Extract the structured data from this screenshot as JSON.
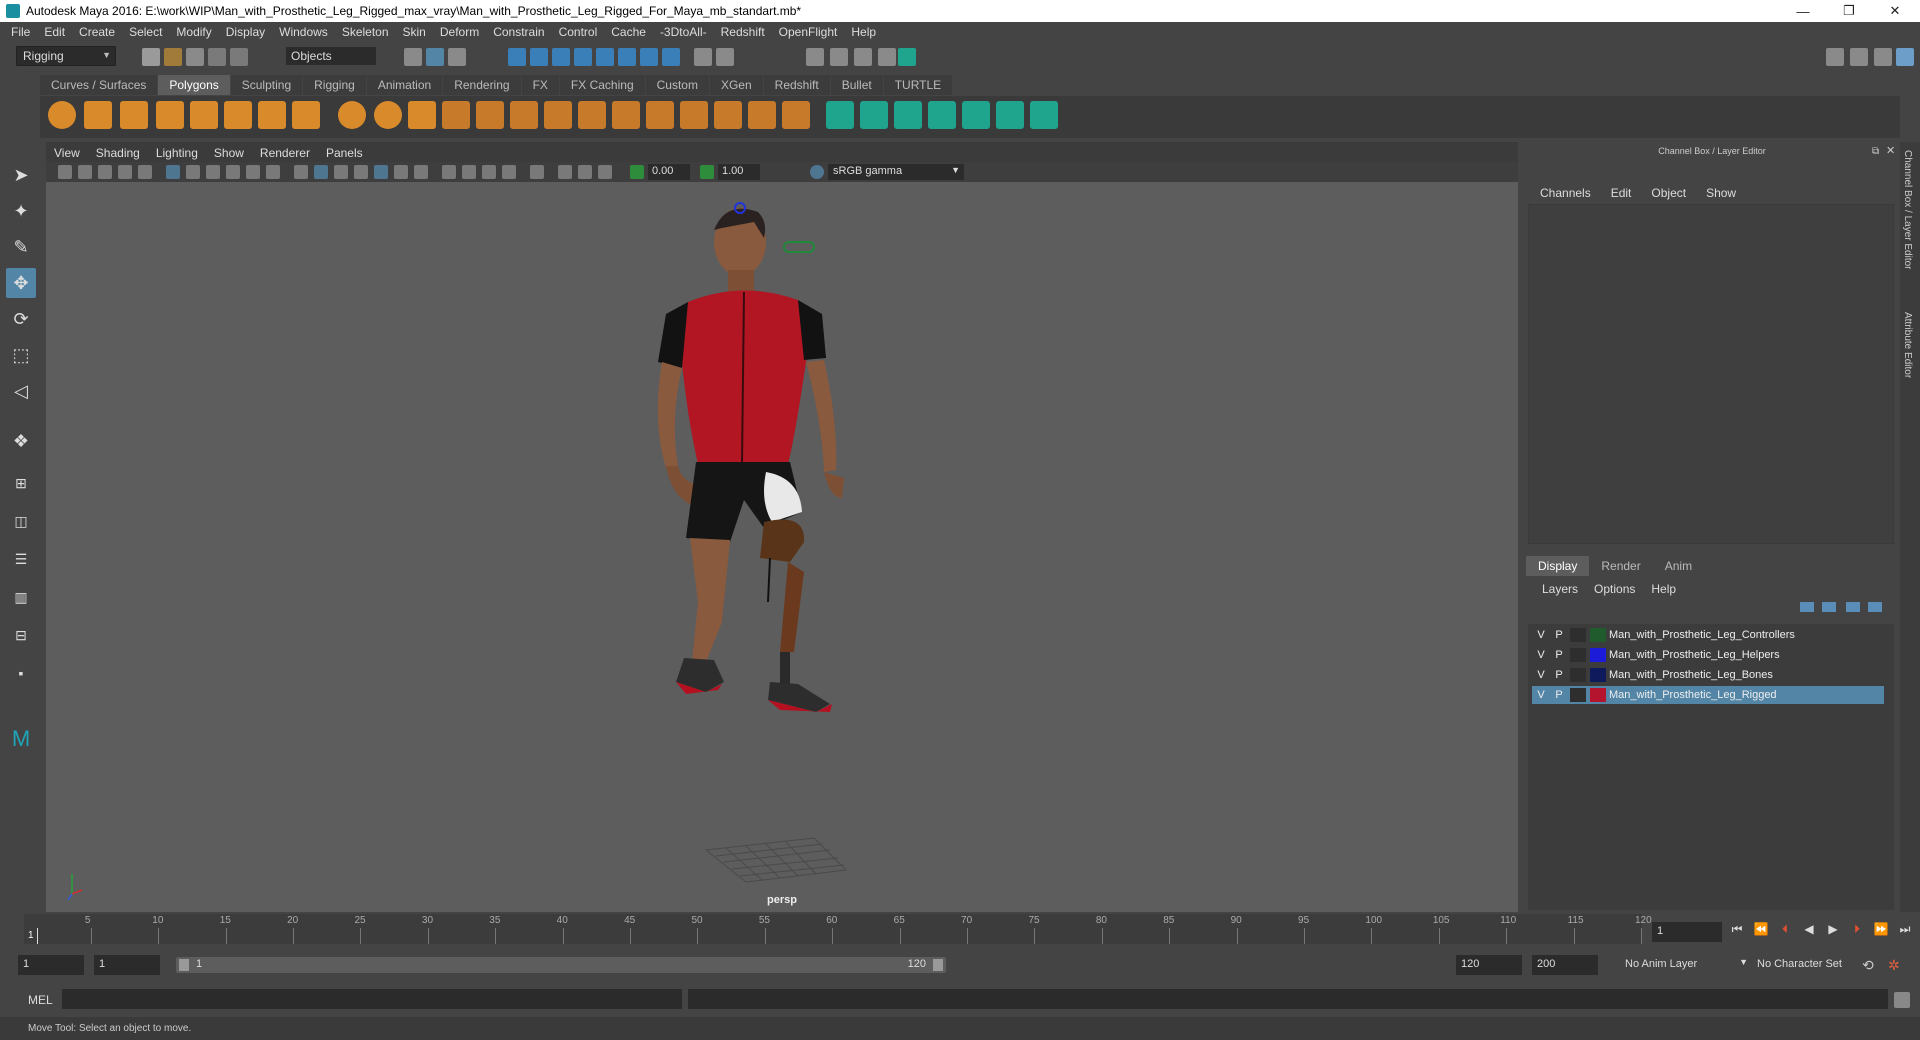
{
  "title_bar": {
    "title": "Autodesk Maya 2016: E:\\work\\WIP\\Man_with_Prosthetic_Leg_Rigged_max_vray\\Man_with_Prosthetic_Leg_Rigged_For_Maya_mb_standart.mb*",
    "minimize": "—",
    "restore": "❐",
    "close": "✕"
  },
  "menu": [
    "File",
    "Edit",
    "Create",
    "Select",
    "Modify",
    "Display",
    "Windows",
    "Skeleton",
    "Skin",
    "Deform",
    "Constrain",
    "Control",
    "Cache",
    "-3DtoAll-",
    "Redshift",
    "OpenFlight",
    "Help"
  ],
  "toolbar": {
    "mode": "Rigging",
    "selection_field": "Objects"
  },
  "shelf_tabs": [
    "Curves / Surfaces",
    "Polygons",
    "Sculpting",
    "Rigging",
    "Animation",
    "Rendering",
    "FX",
    "FX Caching",
    "Custom",
    "XGen",
    "Redshift",
    "Bullet",
    "TURTLE"
  ],
  "active_shelf_tab": "Polygons",
  "panel_menu": [
    "View",
    "Shading",
    "Lighting",
    "Show",
    "Renderer",
    "Panels"
  ],
  "panel_toolbar": {
    "exposure": "0.00",
    "gamma": "1.00",
    "color_space": "sRGB gamma"
  },
  "viewport": {
    "camera_label": "persp"
  },
  "channel_box": {
    "title": "Channel Box / Layer Editor",
    "menu": [
      "Channels",
      "Edit",
      "Object",
      "Show"
    ]
  },
  "layer_editor": {
    "tabs": [
      "Display",
      "Render",
      "Anim"
    ],
    "active_tab": "Display",
    "menu": [
      "Layers",
      "Options",
      "Help"
    ],
    "layers": [
      {
        "v": "V",
        "p": "P",
        "name": "Man_with_Prosthetic_Leg_Controllers",
        "color": "#1f5b2c",
        "selected": false
      },
      {
        "v": "V",
        "p": "P",
        "name": "Man_with_Prosthetic_Leg_Helpers",
        "color": "#1b1bd8",
        "selected": false
      },
      {
        "v": "V",
        "p": "P",
        "name": "Man_with_Prosthetic_Leg_Bones",
        "color": "#0e1a5c",
        "selected": false
      },
      {
        "v": "V",
        "p": "P",
        "name": "Man_with_Prosthetic_Leg_Rigged",
        "color": "#b5142e",
        "selected": true
      }
    ]
  },
  "side_tabs": [
    "Channel Box / Layer Editor",
    "Attribute Editor"
  ],
  "timeline": {
    "ticks": [
      "5",
      "10",
      "15",
      "20",
      "25",
      "30",
      "35",
      "40",
      "45",
      "50",
      "55",
      "60",
      "65",
      "70",
      "75",
      "80",
      "85",
      "90",
      "95",
      "100",
      "105",
      "110",
      "115",
      "120"
    ],
    "start_label": "1",
    "current_frame": "1"
  },
  "range": {
    "start": "1",
    "playback_start": "1",
    "slider_start": "1",
    "slider_end": "120",
    "playback_end": "120",
    "end": "200",
    "anim_layer": "No Anim Layer",
    "character_set": "No Character Set"
  },
  "command_line": {
    "label": "MEL"
  },
  "help_line": {
    "text": "Move Tool: Select an object to move."
  }
}
